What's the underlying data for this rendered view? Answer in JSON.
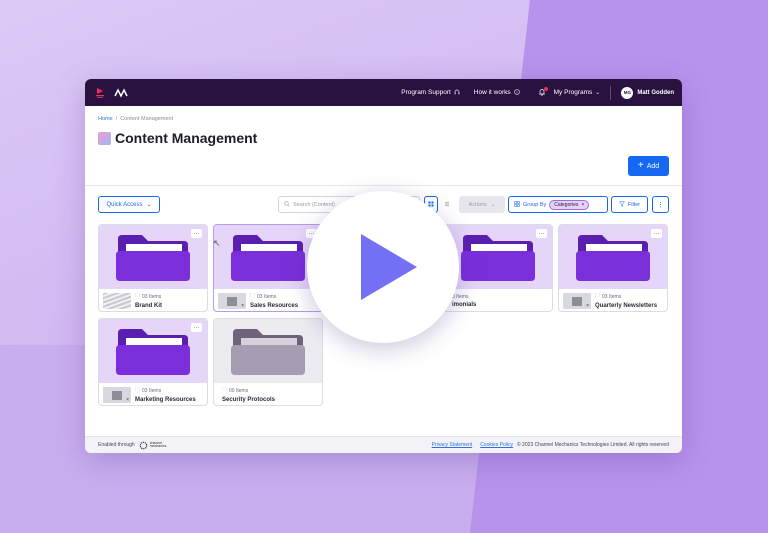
{
  "topnav": {
    "program_support": "Program Support",
    "how_it_works": "How it works",
    "my_programs": "My Programs",
    "user_initials": "MG",
    "user_name": "Matt Godden"
  },
  "header": {
    "breadcrumb_home": "Home",
    "breadcrumb_sep": "/",
    "breadcrumb_current": "Content Management",
    "title": "Content Management",
    "add_label": "Add"
  },
  "toolbar": {
    "quick_access": "Quick Access",
    "search_placeholder": "Search (Content)",
    "actions": "Actions",
    "group_by": "Group By",
    "group_chip": "Categories",
    "filter": "Filter"
  },
  "folders": [
    {
      "name": "Brand Kit",
      "count": "03 Items"
    },
    {
      "name": "Sales Resources",
      "count": "03 Items"
    },
    {
      "name": "",
      "count": ""
    },
    {
      "name": "imonials",
      "count": "3 Items"
    },
    {
      "name": "Quarterly Newsletters",
      "count": "03 Items"
    },
    {
      "name": "Marketing Resources",
      "count": "03 Items"
    },
    {
      "name": "Security Protocols",
      "count": "00 Items"
    }
  ],
  "footer": {
    "enabled_through": "Enabled through",
    "logo_text": "channel mechanics",
    "privacy": "Privacy Statement",
    "cookies": "Cookies Policy",
    "copyright": "© 2023 Channel Mechanics Technologies Limited. All rights reserved"
  },
  "colors": {
    "nav_bg": "#2a1240",
    "accent_blue": "#1668f2",
    "folder_purple": "#7b2fdb",
    "folder_grey": "#8a7f96",
    "play_triangle": "#7370f5"
  },
  "icons": {
    "support": "headset-icon",
    "how_it_works": "info-circle-icon",
    "notifications": "bell-icon",
    "play": "play-icon"
  }
}
